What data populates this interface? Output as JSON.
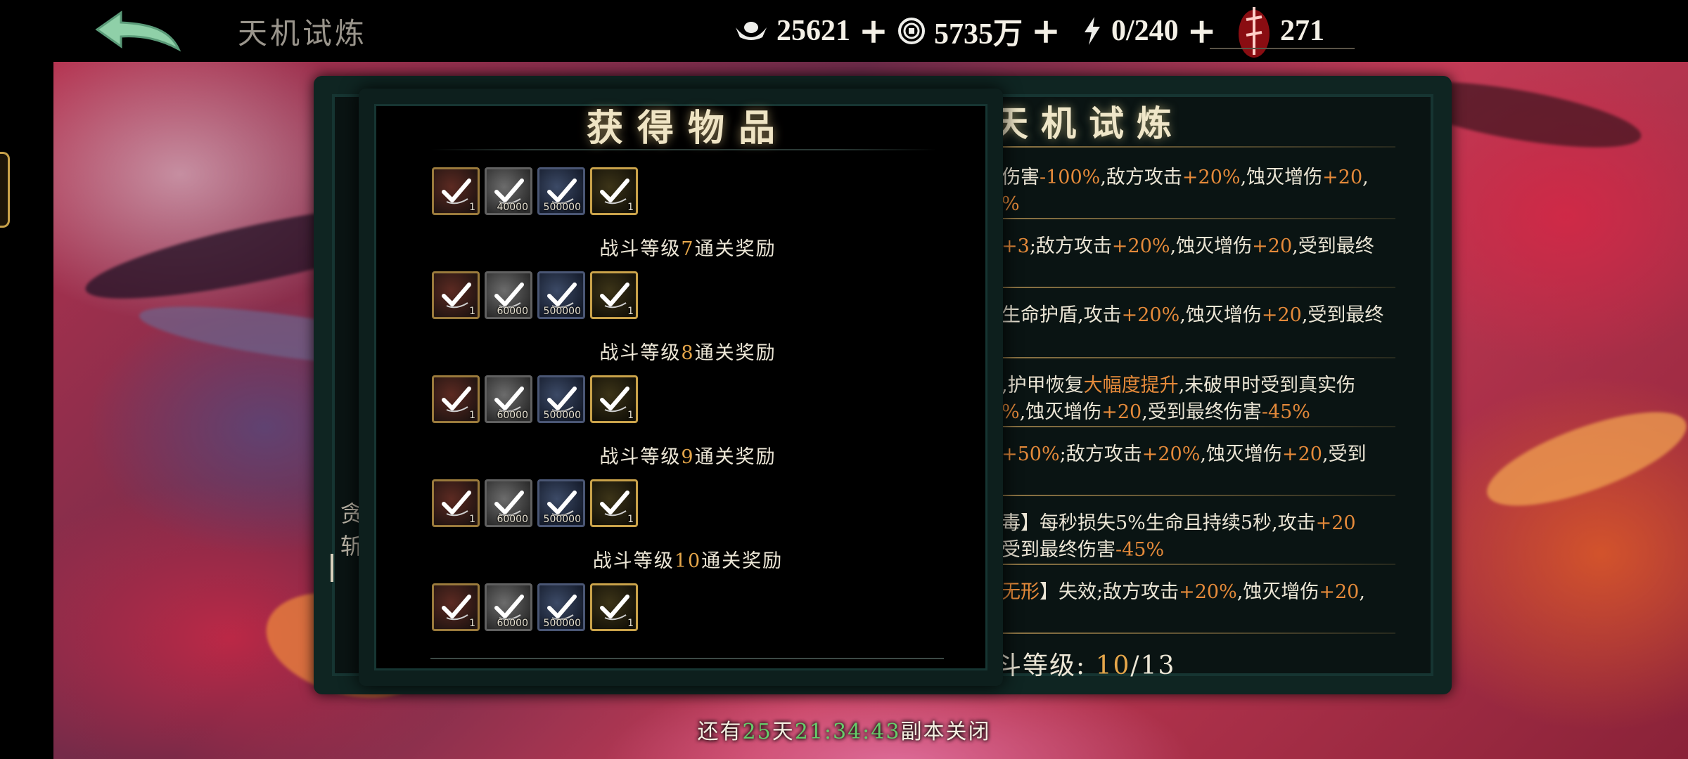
{
  "header": {
    "title": "天机试炼",
    "resources": [
      {
        "icon": "silver-ingot-icon",
        "value": "25621"
      },
      {
        "icon": "copper-coin-icon",
        "value": "5735万"
      },
      {
        "icon": "stamina-bolt-icon",
        "value": "0/240"
      },
      {
        "icon": "red-token-icon",
        "value": "271"
      }
    ]
  },
  "rewards_panel": {
    "title": "获得物品",
    "groups": [
      {
        "label_prefix": "",
        "level": "",
        "label_suffix": "",
        "items": [
          {
            "tier": "red",
            "qty": "1"
          },
          {
            "tier": "grey",
            "qty": "40000"
          },
          {
            "tier": "blue",
            "qty": "500000"
          },
          {
            "tier": "gold",
            "qty": "1"
          }
        ]
      },
      {
        "label_prefix": "战斗等级",
        "level": "7",
        "label_suffix": "通关奖励",
        "items": [
          {
            "tier": "red",
            "qty": "1"
          },
          {
            "tier": "grey",
            "qty": "60000"
          },
          {
            "tier": "blue",
            "qty": "500000"
          },
          {
            "tier": "gold",
            "qty": "1"
          }
        ]
      },
      {
        "label_prefix": "战斗等级",
        "level": "8",
        "label_suffix": "通关奖励",
        "items": [
          {
            "tier": "red",
            "qty": "1"
          },
          {
            "tier": "grey",
            "qty": "60000"
          },
          {
            "tier": "blue",
            "qty": "500000"
          },
          {
            "tier": "gold",
            "qty": "1"
          }
        ]
      },
      {
        "label_prefix": "战斗等级",
        "level": "9",
        "label_suffix": "通关奖励",
        "items": [
          {
            "tier": "red",
            "qty": "1"
          },
          {
            "tier": "grey",
            "qty": "60000"
          },
          {
            "tier": "blue",
            "qty": "500000"
          },
          {
            "tier": "gold",
            "qty": "1"
          }
        ]
      },
      {
        "label_prefix": "战斗等级",
        "level": "10",
        "label_suffix": "通关奖励",
        "items": [
          {
            "tier": "red",
            "qty": "1"
          },
          {
            "tier": "grey",
            "qty": "60000"
          },
          {
            "tier": "blue",
            "qty": "500000"
          },
          {
            "tier": "gold",
            "qty": "1"
          }
        ]
      }
    ]
  },
  "trial_panel": {
    "title": "天机试炼",
    "rows": [
      [
        [
          "伤害",
          ""
        ],
        [
          "-100%",
          "hl"
        ],
        [
          ",敌方攻击",
          ""
        ],
        [
          "+20%",
          "hl"
        ],
        [
          ",蚀灭增伤",
          ""
        ],
        [
          "+20",
          "hl"
        ],
        [
          ",",
          ""
        ]
      ],
      [
        [
          "%",
          "hl"
        ]
      ],
      [
        [
          "+3",
          "hl"
        ],
        [
          ";敌方攻击",
          ""
        ],
        [
          "+20%",
          "hl"
        ],
        [
          ",蚀灭增伤",
          ""
        ],
        [
          "+20",
          "hl"
        ],
        [
          ",受到最终",
          ""
        ]
      ],
      [
        [
          "生命护盾,攻击",
          ""
        ],
        [
          "+20%",
          "hl"
        ],
        [
          ",蚀灭增伤",
          ""
        ],
        [
          "+20",
          "hl"
        ],
        [
          ",受到最终",
          ""
        ]
      ],
      [
        [
          ",护甲恢复",
          ""
        ],
        [
          "大幅度提升",
          "hl"
        ],
        [
          ",未破甲时受到真实伤",
          ""
        ]
      ],
      [
        [
          "%",
          "hl"
        ],
        [
          ",蚀灭增伤",
          ""
        ],
        [
          "+20",
          "hl"
        ],
        [
          ",受到最终伤害",
          ""
        ],
        [
          "-45%",
          "hl"
        ]
      ],
      [
        [
          "+50%",
          "hl"
        ],
        [
          ";敌方攻击",
          ""
        ],
        [
          "+20%",
          "hl"
        ],
        [
          ",蚀灭增伤",
          ""
        ],
        [
          "+20",
          "hl"
        ],
        [
          ",受到",
          ""
        ]
      ],
      [
        [
          "毒】每秒损失5%生命且持续5秒,攻击",
          ""
        ],
        [
          "+20",
          "hl"
        ]
      ],
      [
        [
          "受到最终伤害",
          ""
        ],
        [
          "-45%",
          "hl"
        ]
      ],
      [
        [
          "无形",
          "hl"
        ],
        [
          "】失效;敌方攻击",
          ""
        ],
        [
          "+20%",
          "hl"
        ],
        [
          ",蚀灭增伤",
          ""
        ],
        [
          "+20",
          "hl"
        ],
        [
          ",",
          ""
        ]
      ]
    ],
    "left_fragment": [
      "贪",
      "斩"
    ],
    "stage_prefix": "斗等级:",
    "stage_current": "10",
    "stage_total": "/13"
  },
  "countdown": {
    "prefix": "还有",
    "days": "25",
    "days_unit": "天",
    "time": "21:34:43",
    "suffix": "副本关闭"
  },
  "colors": {
    "highlight": "#e58a3a",
    "level": "#e5a64a",
    "countdown": "#66cc6a",
    "gold_frame": "#c9a24a"
  }
}
